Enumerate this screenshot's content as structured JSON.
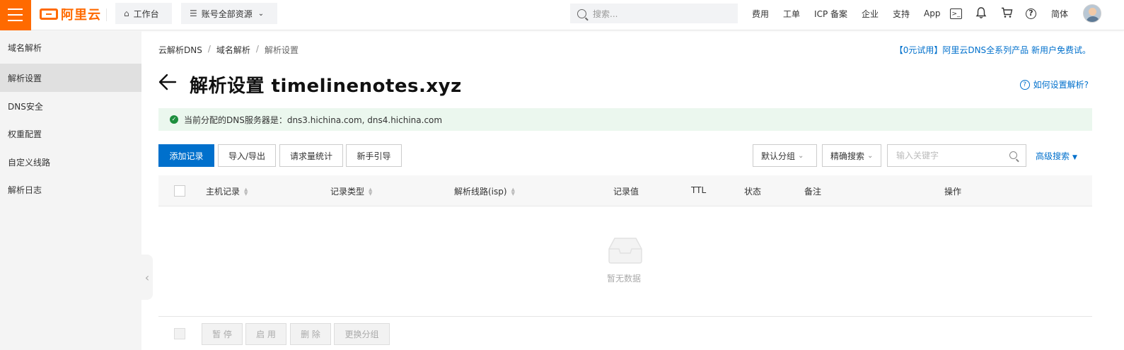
{
  "topbar": {
    "logo_text": "阿里云",
    "workbench": "工作台",
    "account_resources": "账号全部资源",
    "search_placeholder": "搜索...",
    "links": [
      "费用",
      "工单",
      "ICP 备案",
      "企业",
      "支持",
      "App"
    ],
    "lang": "简体"
  },
  "sidebar": {
    "items": [
      {
        "label": "域名解析",
        "active": false
      },
      {
        "label": "解析设置",
        "active": true
      },
      {
        "label": "DNS安全",
        "active": false
      },
      {
        "label": "权重配置",
        "active": false
      },
      {
        "label": "自定义线路",
        "active": false
      },
      {
        "label": "解析日志",
        "active": false
      }
    ]
  },
  "breadcrumb": [
    "云解析DNS",
    "域名解析",
    "解析设置"
  ],
  "promo": "【0元试用】阿里云DNS全系列产品 新用户免费试。",
  "page_title": "解析设置 timelinenotes.xyz",
  "help_link": "如何设置解析?",
  "notice": "当前分配的DNS服务器是：dns3.hichina.com, dns4.hichina.com",
  "toolbar": {
    "add": "添加记录",
    "import_export": "导入/导出",
    "stats": "请求量统计",
    "guide": "新手引导",
    "group_select": "默认分组",
    "precise_search": "精确搜索",
    "keyword_placeholder": "输入关键字",
    "advanced": "高级搜索"
  },
  "table": {
    "columns": [
      "主机记录",
      "记录类型",
      "解析线路(isp)",
      "记录值",
      "TTL",
      "状态",
      "备注",
      "操作"
    ],
    "rows": [],
    "empty_text": "暂无数据"
  },
  "footer": {
    "pause": "暂 停",
    "enable": "启 用",
    "delete": "删 除",
    "change_group": "更换分组"
  },
  "colors": {
    "brand": "#ff6a00",
    "primary": "#0070cc",
    "success_bg": "#ebf7ee"
  }
}
